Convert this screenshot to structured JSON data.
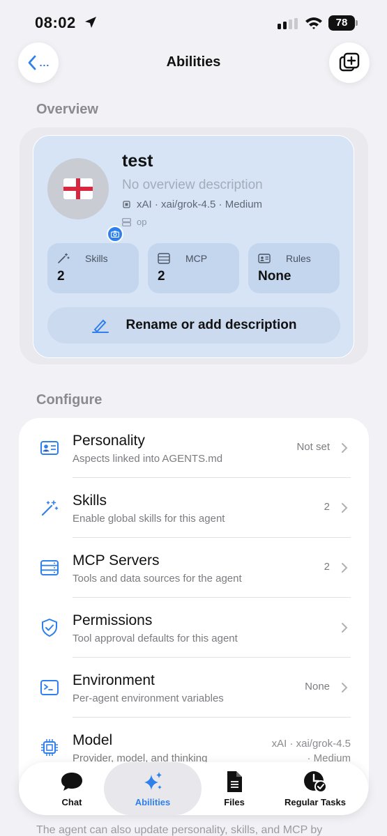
{
  "status_bar": {
    "time": "08:02",
    "battery": "78"
  },
  "nav": {
    "back_dots": "...",
    "title": "Abilities"
  },
  "overview": {
    "section_title": "Overview",
    "agent_name": "test",
    "description_placeholder": "No overview description",
    "model_line": "xAI · xai/grok-4.5 · Medium",
    "environment": "op",
    "stats": [
      {
        "label": "Skills",
        "value": "2",
        "icon": "magic-wand-icon"
      },
      {
        "label": "MCP",
        "value": "2",
        "icon": "server-icon"
      },
      {
        "label": "Rules",
        "value": "None",
        "icon": "id-card-icon"
      }
    ],
    "rename_label": "Rename or add description"
  },
  "configure": {
    "section_title": "Configure",
    "rows": [
      {
        "title": "Personality",
        "subtitle": "Aspects linked into AGENTS.md",
        "value": "Not set",
        "icon": "id-card-icon"
      },
      {
        "title": "Skills",
        "subtitle": "Enable global skills for this agent",
        "value": "2",
        "icon": "magic-wand-icon"
      },
      {
        "title": "MCP Servers",
        "subtitle": "Tools and data sources for the agent",
        "value": "2",
        "icon": "server-icon"
      },
      {
        "title": "Permissions",
        "subtitle": "Tool approval defaults for this agent",
        "value": "",
        "icon": "shield-check-icon"
      },
      {
        "title": "Environment",
        "subtitle": "Per-agent environment variables",
        "value": "None",
        "icon": "terminal-icon"
      },
      {
        "title": "Model",
        "subtitle": "Provider, model, and thinking",
        "value_line1": "xAI · xai/grok-4.5",
        "value_line2": "· Medium",
        "icon": "chip-icon"
      }
    ]
  },
  "footer_note": "The agent can also update personality, skills, and MCP by",
  "tabs": [
    {
      "label": "Chat",
      "icon": "chat-bubble-icon",
      "active": false
    },
    {
      "label": "Abilities",
      "icon": "sparkles-icon",
      "active": true
    },
    {
      "label": "Files",
      "icon": "document-icon",
      "active": false
    },
    {
      "label": "Regular Tasks",
      "icon": "clock-check-icon",
      "active": false
    }
  ],
  "colors": {
    "accent": "#2f80ed",
    "card_bg": "#d6e4f6",
    "page_bg": "#f2f2f6"
  }
}
